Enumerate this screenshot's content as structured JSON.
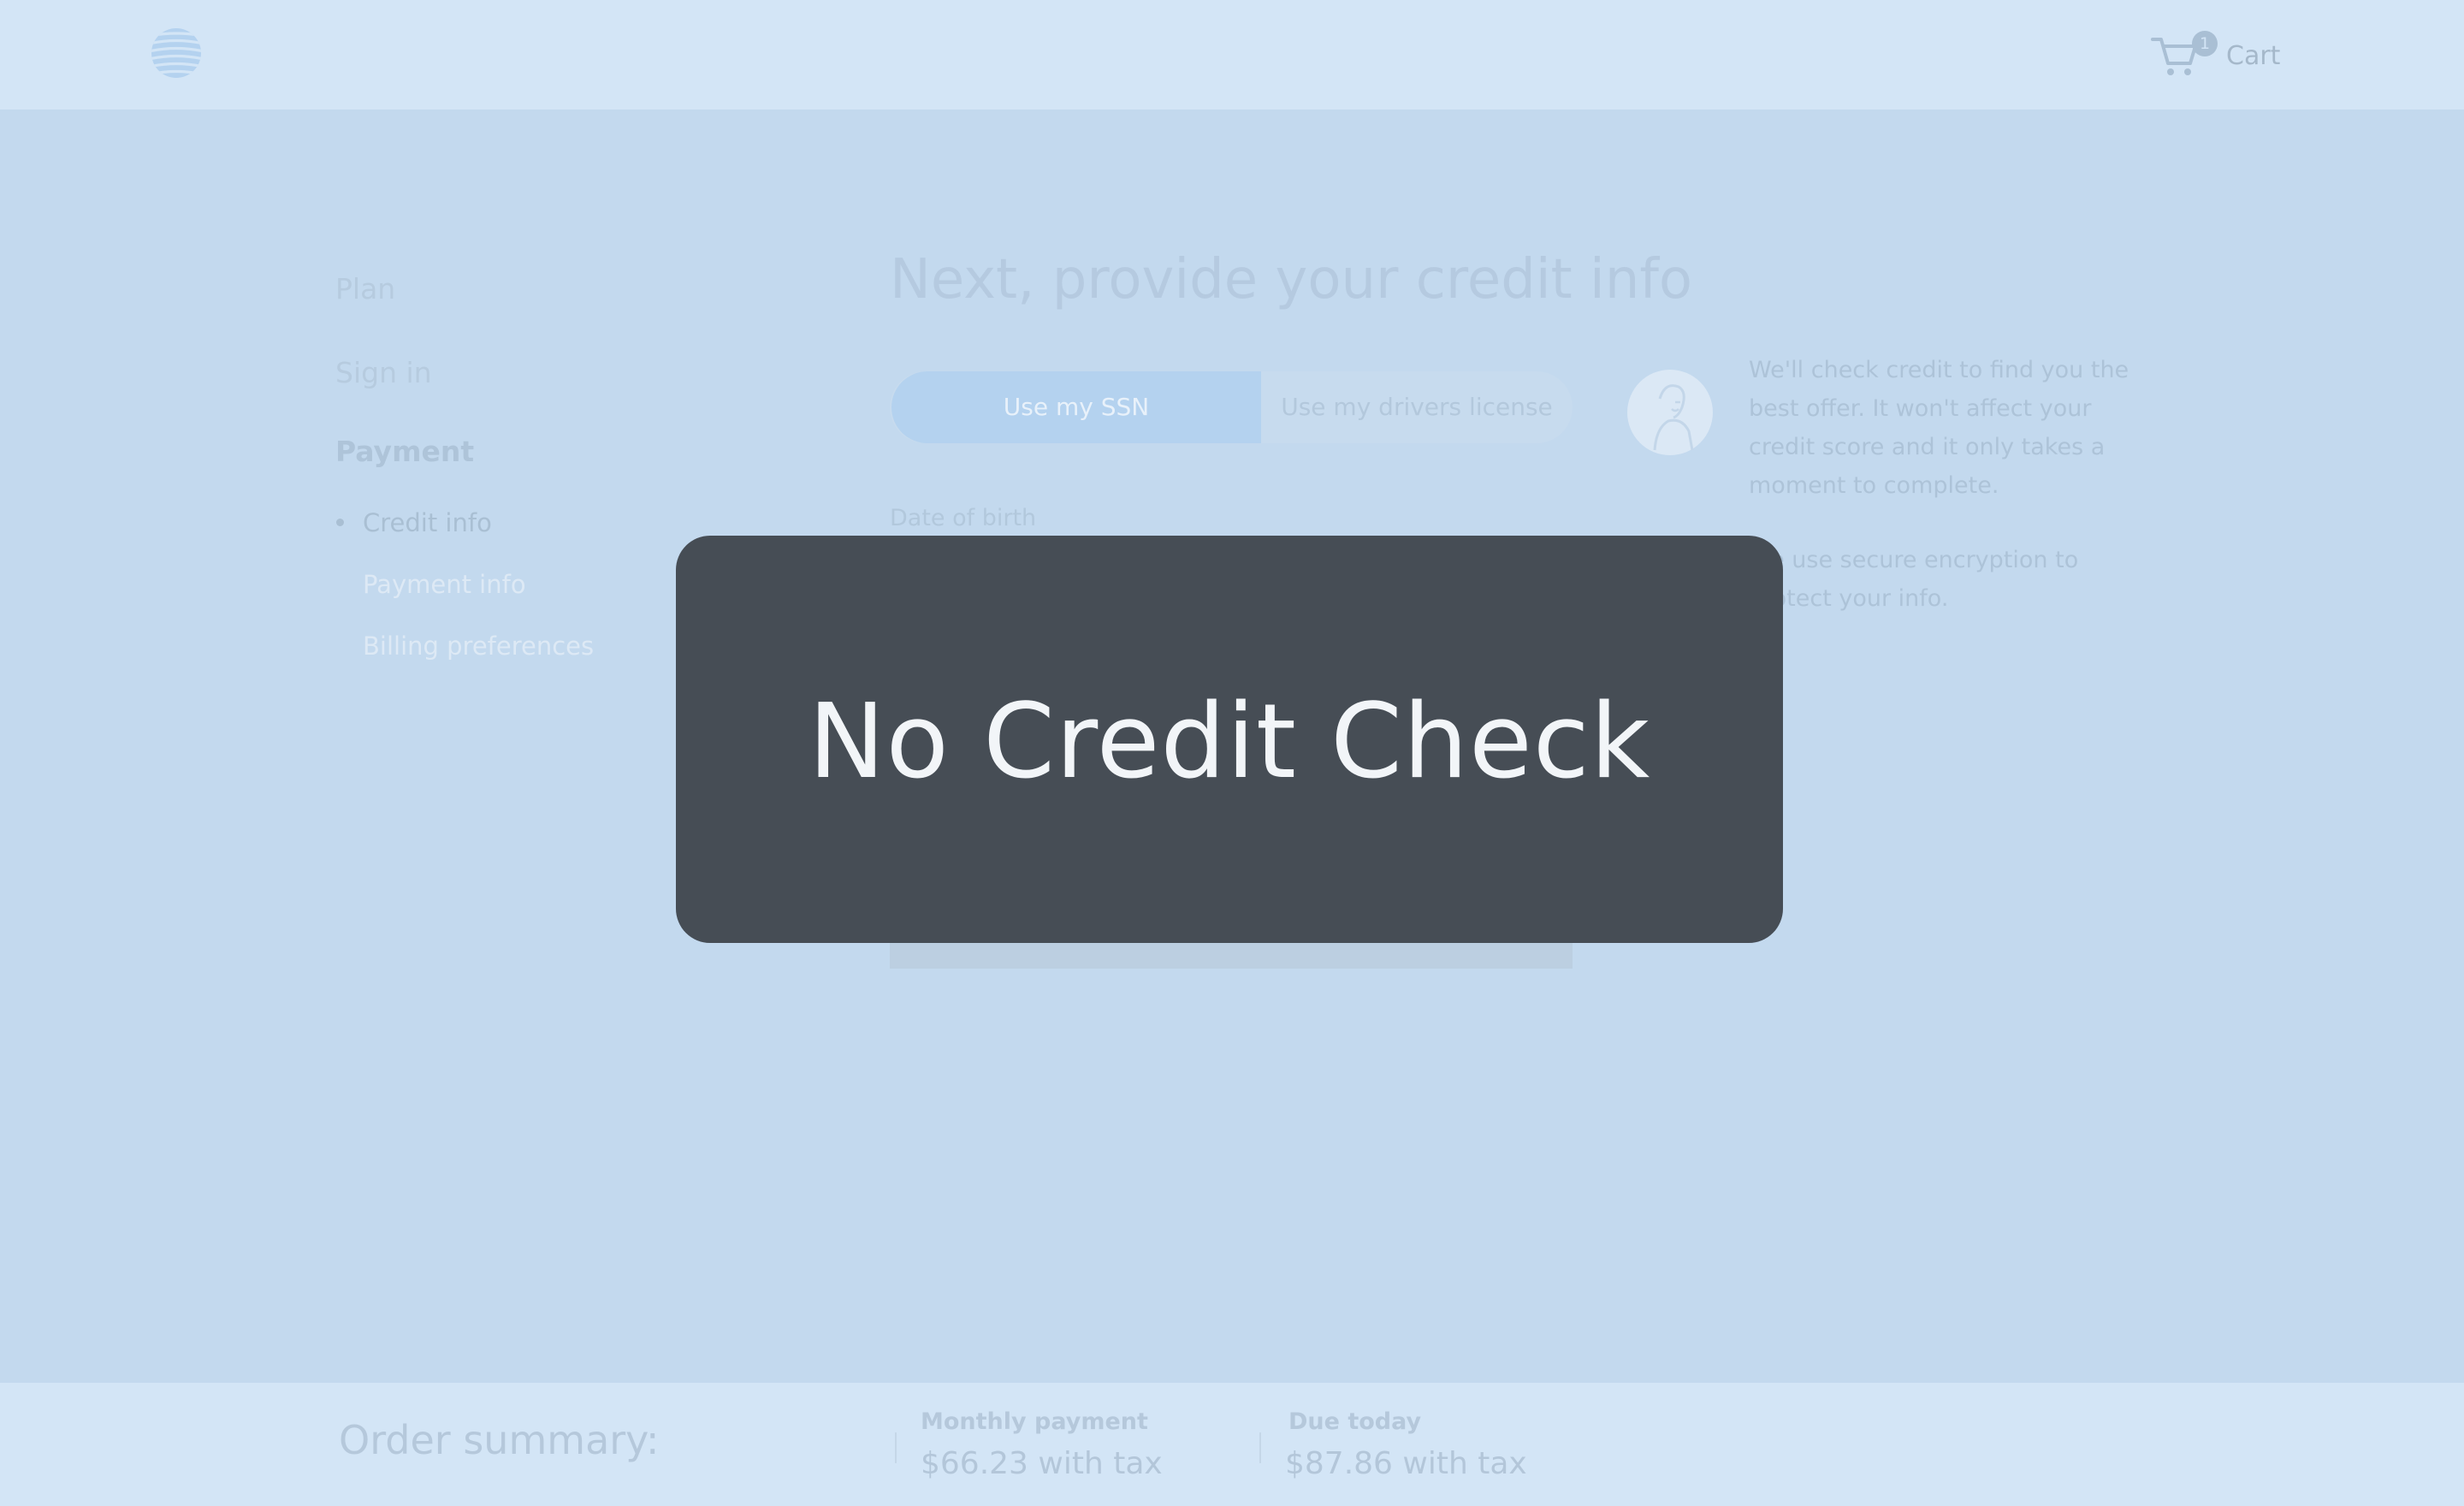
{
  "header": {
    "logo_icon": "att-globe-icon",
    "cart": {
      "icon": "cart-icon",
      "count": "1",
      "label": "Cart"
    }
  },
  "steps": {
    "plan": "Plan",
    "sign_in": "Sign in",
    "payment": "Payment",
    "sub_steps": {
      "credit_info": "Credit info",
      "payment_info": "Payment info",
      "billing_preferences": "Billing preferences"
    }
  },
  "main": {
    "title": "Next, provide your credit info",
    "toggle": {
      "option_ssn": "Use my SSN",
      "option_other": "Use my drivers license"
    },
    "field_label": "Date of birth"
  },
  "info": {
    "icon": "person-portrait-icon",
    "paragraph_1": "We'll check credit to find you the best offer. It won't affect your credit score and it only takes a moment to complete.",
    "paragraph_2": "We use secure encryption to protect your info."
  },
  "modal": {
    "text": "No Credit Check"
  },
  "footer": {
    "order_summary": "Order summary:",
    "monthly_label": "Monthly payment",
    "monthly_value": "$66.23 with tax",
    "due_label": "Due today",
    "due_value": "$87.86 with tax"
  },
  "colors": {
    "page_background": "#c3d9ee",
    "header_background": "#d3e5f6",
    "toggle_active": "#b4d2ef",
    "modal_background": "#464d55",
    "modal_text": "#f2f5f8"
  }
}
